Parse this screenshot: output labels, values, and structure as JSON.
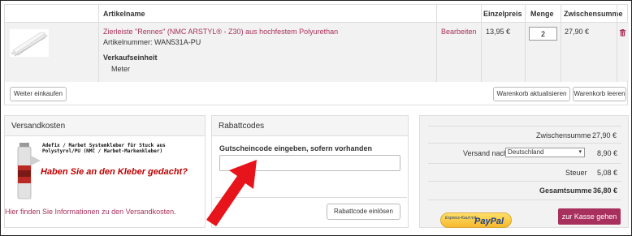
{
  "cart": {
    "headers": {
      "article_name": "Artikelname",
      "unit_price": "Einzelpreis",
      "quantity": "Menge",
      "subtotal": "Zwischensumme"
    },
    "item": {
      "name": "Zierleiste \"Rennes\" (NMC ARSTYL® - Z30) aus hochfestem Polyurethan",
      "sku": "Artikelnummer: WAN531A-PU",
      "unit_label": "Verkaufseinheit",
      "unit_value": "Meter",
      "edit": "Bearbeiten",
      "price": "13,95 €",
      "quantity": "2",
      "subtotal": "27,90 €"
    },
    "continue_shopping": "Weiter einkaufen",
    "update_cart": "Warenkorb aktualisieren",
    "clear_cart": "Warenkorb leeren"
  },
  "shipping": {
    "title": "Versandkosten",
    "ad_small": "Adefix / Marbet Systemkleber für Stuck aus Polystyrol/PU (NMC / Marbet-Markenkleber)",
    "ad_big": "Haben Sie an den Kleber gedacht?",
    "link": "Hier finden Sie Informationen zu den Versandkosten."
  },
  "coupon": {
    "title": "Rabattcodes",
    "label": "Gutscheincode eingeben, sofern vorhanden",
    "value": "",
    "button": "Rabattcode einlösen"
  },
  "totals": {
    "subtotal_label": "Zwischensumme",
    "subtotal_value": "27,90 €",
    "shipping_label": "Versand nach",
    "country": "Deutschland",
    "shipping_value": "8,90 €",
    "tax_label": "Steuer",
    "tax_value": "5,08 €",
    "total_label": "Gesamtsumme",
    "total_value": "36,80 €",
    "checkout": "zur Kasse gehen",
    "paypal_small": "Express-Kauf mit",
    "paypal_big": "PayPal"
  },
  "colors": {
    "accent": "#a8305c",
    "arrow": "#e8141b"
  }
}
